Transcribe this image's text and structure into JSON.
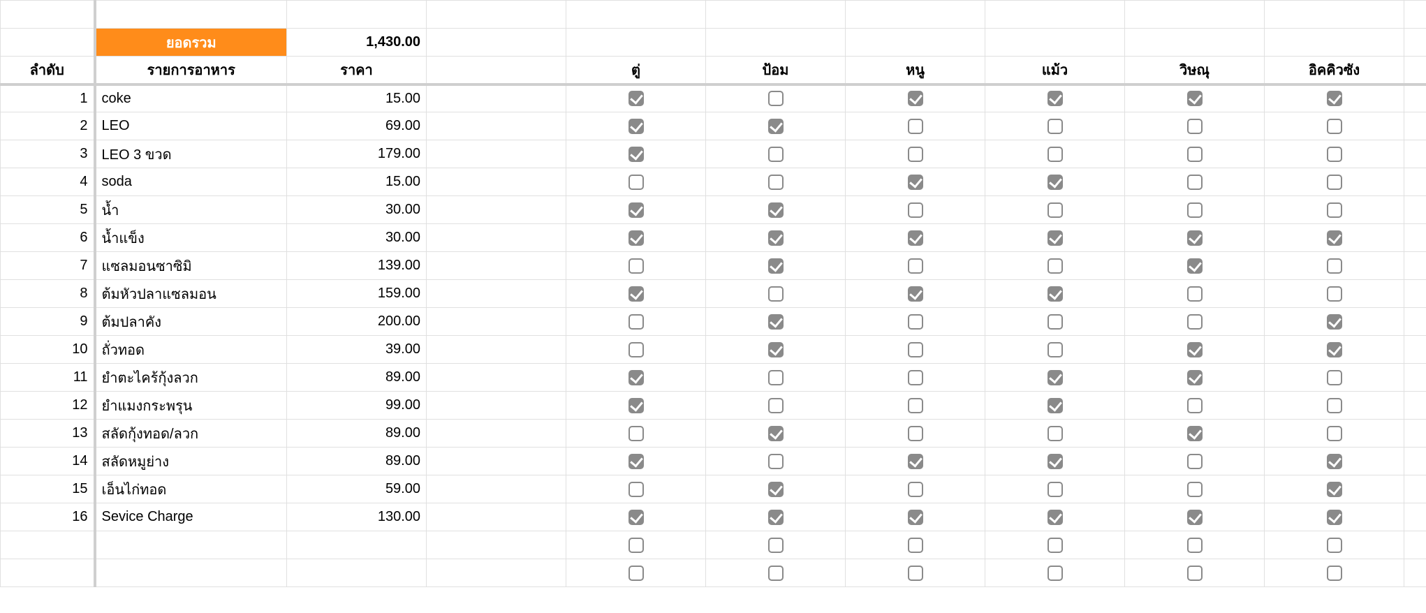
{
  "summary": {
    "label": "ยอดรวม",
    "total": "1,430.00"
  },
  "columns": {
    "seq": "ลำดับ",
    "item": "รายการอาหาร",
    "price": "ราคา",
    "people": [
      "ตู่",
      "ป้อม",
      "หนู",
      "แม้ว",
      "วิษณุ",
      "อิคคิวซัง"
    ]
  },
  "rows": [
    {
      "seq": "1",
      "item": "coke",
      "price": "15.00",
      "checks": [
        true,
        false,
        true,
        true,
        true,
        true
      ]
    },
    {
      "seq": "2",
      "item": "LEO",
      "price": "69.00",
      "checks": [
        true,
        true,
        false,
        false,
        false,
        false
      ]
    },
    {
      "seq": "3",
      "item": "LEO 3 ขวด",
      "price": "179.00",
      "checks": [
        true,
        false,
        false,
        false,
        false,
        false
      ]
    },
    {
      "seq": "4",
      "item": "soda",
      "price": "15.00",
      "checks": [
        false,
        false,
        true,
        true,
        false,
        false
      ]
    },
    {
      "seq": "5",
      "item": "น้ำ",
      "price": "30.00",
      "checks": [
        true,
        true,
        false,
        false,
        false,
        false
      ]
    },
    {
      "seq": "6",
      "item": "น้ำแข็ง",
      "price": "30.00",
      "checks": [
        true,
        true,
        true,
        true,
        true,
        true
      ]
    },
    {
      "seq": "7",
      "item": "แซลมอนซาซิมิ",
      "price": "139.00",
      "checks": [
        false,
        true,
        false,
        false,
        true,
        false
      ]
    },
    {
      "seq": "8",
      "item": "ต้มหัวปลาแซลมอน",
      "price": "159.00",
      "checks": [
        true,
        false,
        true,
        true,
        false,
        false
      ]
    },
    {
      "seq": "9",
      "item": "ต้มปลาคัง",
      "price": "200.00",
      "checks": [
        false,
        true,
        false,
        false,
        false,
        true
      ]
    },
    {
      "seq": "10",
      "item": "ถั่วทอด",
      "price": "39.00",
      "checks": [
        false,
        true,
        false,
        false,
        true,
        true
      ]
    },
    {
      "seq": "11",
      "item": "ยำตะไคร้กุ้งลวก",
      "price": "89.00",
      "checks": [
        true,
        false,
        false,
        true,
        true,
        false
      ]
    },
    {
      "seq": "12",
      "item": "ยำแมงกระพรุน",
      "price": "99.00",
      "checks": [
        true,
        false,
        false,
        true,
        false,
        false
      ]
    },
    {
      "seq": "13",
      "item": "สลัดกุ้งทอด/ลวก",
      "price": "89.00",
      "checks": [
        false,
        true,
        false,
        false,
        true,
        false
      ]
    },
    {
      "seq": "14",
      "item": "สลัดหมูย่าง",
      "price": "89.00",
      "checks": [
        true,
        false,
        true,
        true,
        false,
        true
      ]
    },
    {
      "seq": "15",
      "item": "เอ็นไก่ทอด",
      "price": "59.00",
      "checks": [
        false,
        true,
        false,
        false,
        false,
        true
      ]
    },
    {
      "seq": "16",
      "item": "Sevice Charge",
      "price": "130.00",
      "checks": [
        true,
        true,
        true,
        true,
        true,
        true
      ]
    }
  ],
  "blankRows": [
    {
      "checks": [
        false,
        false,
        false,
        false,
        false,
        false
      ]
    },
    {
      "checks": [
        false,
        false,
        false,
        false,
        false,
        false
      ]
    }
  ],
  "colWidths": {
    "seq": 135,
    "item": 275,
    "price": 200,
    "gap1": 200,
    "person": 200
  }
}
